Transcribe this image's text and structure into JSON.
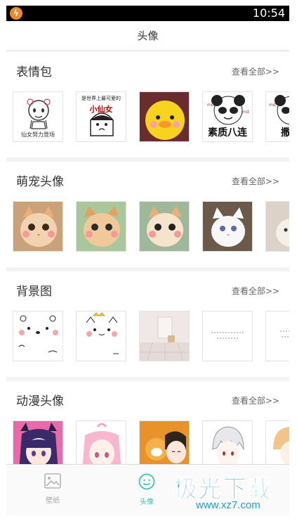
{
  "status_bar": {
    "time": "10:54",
    "app_icon": "lightning-icon"
  },
  "header": {
    "title": "头像"
  },
  "sections": [
    {
      "title": "表情包",
      "more": "查看全部>>",
      "thumbs": [
        {
          "kind": "meme-fairy",
          "caption": "仙女努力登场"
        },
        {
          "kind": "meme-girl",
          "caption_top": "是世界上最可爱的",
          "caption_big": "小仙女"
        },
        {
          "kind": "duck"
        },
        {
          "kind": "panda",
          "caption": "素质八连"
        },
        {
          "kind": "panda2",
          "caption": "撒娇"
        }
      ]
    },
    {
      "title": "萌宠头像",
      "more": "查看全部>>",
      "thumbs": [
        {
          "kind": "cat1"
        },
        {
          "kind": "cat2"
        },
        {
          "kind": "cat3"
        },
        {
          "kind": "cat4"
        },
        {
          "kind": "cat5"
        }
      ]
    },
    {
      "title": "背景图",
      "more": "查看全部>>",
      "thumbs": [
        {
          "kind": "bear-doodle"
        },
        {
          "kind": "cat-doodle"
        },
        {
          "kind": "room"
        },
        {
          "kind": "text-note"
        },
        {
          "kind": "text-note2"
        }
      ]
    },
    {
      "title": "动漫头像",
      "more": "查看全部>>",
      "thumbs": [
        {
          "kind": "anime1"
        },
        {
          "kind": "anime2"
        },
        {
          "kind": "anime3"
        },
        {
          "kind": "anime4"
        },
        {
          "kind": "anime5"
        }
      ]
    }
  ],
  "tabs": [
    {
      "label": "壁纸",
      "icon": "wallpaper-icon",
      "active": false
    },
    {
      "label": "头像",
      "icon": "smiley-icon",
      "active": true
    }
  ],
  "watermark": {
    "main": "极光下载",
    "sub": "www.xz7.com"
  },
  "colors": {
    "accent": "#3cc4b4",
    "watermark": "#1aa0d8",
    "status_icon": "#f08a24"
  }
}
